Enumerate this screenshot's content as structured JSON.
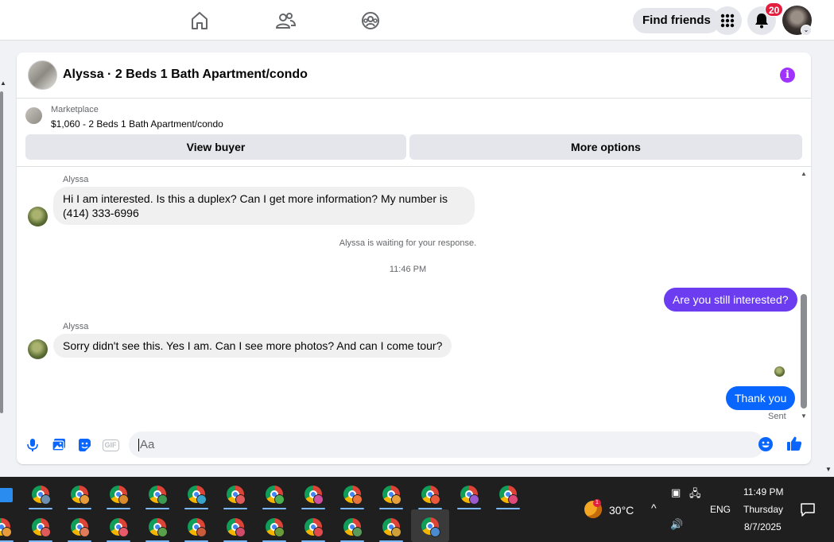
{
  "topnav": {
    "find_friends_label": "Find friends",
    "notification_count": "20"
  },
  "conversation": {
    "title": "Alyssa · 2 Beds 1 Bath Apartment/condo",
    "marketplace_label": "Marketplace",
    "listing": "$1,060 - 2 Beds 1 Bath Apartment/condo",
    "view_buyer_label": "View buyer",
    "more_options_label": "More options"
  },
  "messages": {
    "sender1": "Alyssa",
    "msg1": "Hi I am interested. Is this a duplex? Can I get more information? My number is (414) 333-6996",
    "waiting_note": "Alyssa is waiting for your response.",
    "timestamp": "11:46 PM",
    "out1": "Are you still interested?",
    "sender2": "Alyssa",
    "msg2": "Sorry didn't see this. Yes I am. Can I see more photos? And can I come tour?",
    "out2": "Thank you",
    "status": "Sent"
  },
  "composer": {
    "placeholder": "Aa",
    "gif_label": "GIF"
  },
  "taskbar": {
    "temperature": "30°C",
    "weather_badge": "1",
    "language": "ENG",
    "time": "11:49 PM",
    "day": "Thursday",
    "date": "8/7/2025"
  },
  "colors": {
    "accent_blue": "#0866ff",
    "bubble_purple": "#6b3cf0",
    "info_purple": "#a033ff"
  }
}
